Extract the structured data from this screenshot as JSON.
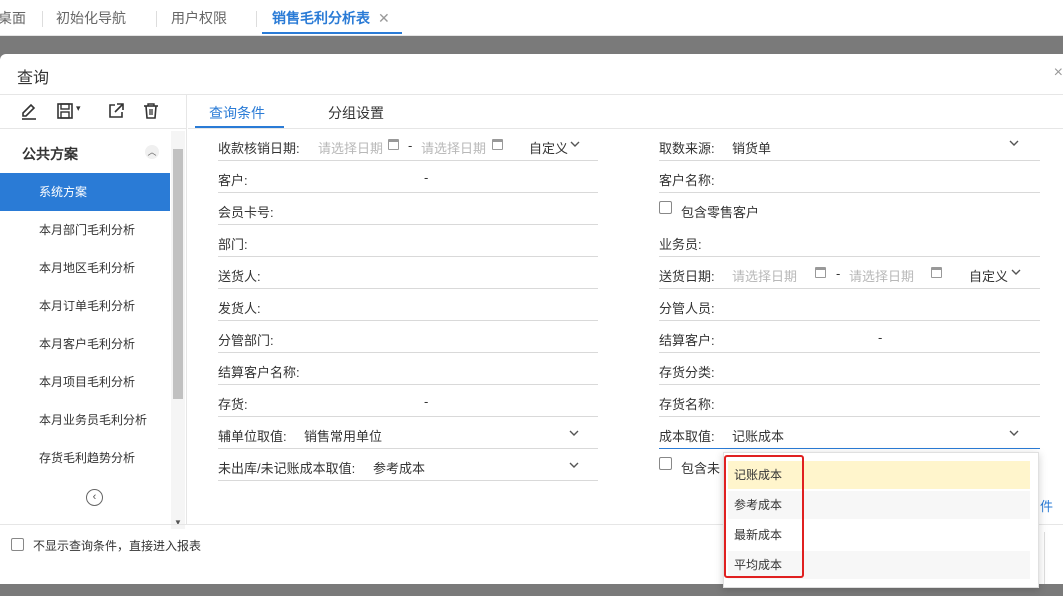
{
  "tabs": [
    {
      "label": "桌面",
      "active": false
    },
    {
      "label": "初始化导航",
      "active": false
    },
    {
      "label": "用户权限",
      "active": false
    },
    {
      "label": "销售毛利分析表",
      "active": true
    }
  ],
  "tab_close": "✕",
  "dialog": {
    "title": "查询",
    "close": "×"
  },
  "toolbar": {
    "icons": [
      "edit-icon",
      "save-icon",
      "export-icon",
      "delete-icon"
    ]
  },
  "schemes": {
    "group_label": "公共方案",
    "items": [
      "系统方案",
      "本月部门毛利分析",
      "本月地区毛利分析",
      "本月订单毛利分析",
      "本月客户毛利分析",
      "本月项目毛利分析",
      "本月业务员毛利分析",
      "存货毛利趋势分析"
    ]
  },
  "main_tabs": [
    "查询条件",
    "分组设置"
  ],
  "left_fields": {
    "date_label": "收款核销日期:",
    "date_start_ph": "请选择日期",
    "date_end_ph": "请选择日期",
    "date_sep": "-",
    "date_mode": "自定义",
    "customer": "客户:",
    "customer_sep": "-",
    "member_card": "会员卡号:",
    "department": "部门:",
    "shipper": "送货人:",
    "sender": "发货人:",
    "managed_dept": "分管部门:",
    "settle_cust_name": "结算客户名称:",
    "inventory": "存货:",
    "inventory_sep": "-",
    "aux_unit_label": "辅单位取值:",
    "aux_unit_value": "销售常用单位",
    "unposted_label": "未出库/未记账成本取值:",
    "unposted_value": "参考成本"
  },
  "right_fields": {
    "source_label": "取数来源:",
    "source_value": "销货单",
    "customer_name": "客户名称:",
    "include_retail": "包含零售客户",
    "salesperson": "业务员:",
    "delivery_date_label": "送货日期:",
    "delivery_start_ph": "请选择日期",
    "delivery_end_ph": "请选择日期",
    "delivery_sep": "-",
    "delivery_mode": "自定义",
    "manager": "分管人员:",
    "settle_cust": "结算客户:",
    "settle_cust_sep": "-",
    "inv_category": "存货分类:",
    "inv_name": "存货名称:",
    "cost_label": "成本取值:",
    "cost_value": "记账成本",
    "include_unposted_partial": "包含未",
    "partial_link": "件"
  },
  "cost_options": [
    "记账成本",
    "参考成本",
    "最新成本",
    "平均成本"
  ],
  "footer": {
    "skip_query": "不显示查询条件，直接进入报表"
  }
}
